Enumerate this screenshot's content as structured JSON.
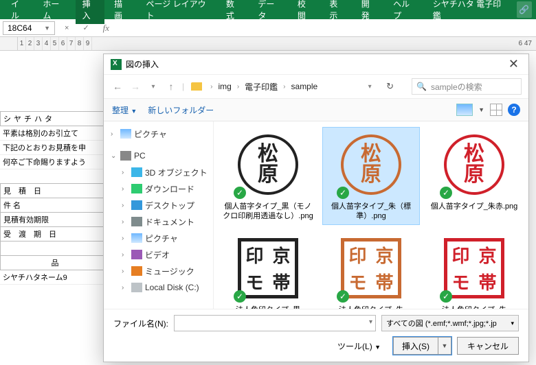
{
  "ribbon": {
    "tabs": [
      "イル",
      "ホーム",
      "挿入",
      "描画",
      "ページ レイアウト",
      "数式",
      "データ",
      "校閲",
      "表示",
      "開発",
      "ヘルプ",
      "シヤチハタ 電子印鑑"
    ]
  },
  "formula_bar": {
    "namebox": "18C64",
    "fx": "fx"
  },
  "colhdr_right": "6 47",
  "sheet": {
    "header_cells": [
      "シ",
      "ヤ",
      "チ",
      "ハ",
      "タ"
    ],
    "para": [
      "平素は格別のお引立て",
      "下記のとおりお見積を申",
      "何卒ご下命賜りますよう"
    ],
    "rows": [
      "見　積　日",
      "件 名",
      "見積有効期限",
      "受　渡　期　日",
      "",
      "品"
    ],
    "footer": "シヤチハタネーム9"
  },
  "dialog": {
    "title": "図の挿入",
    "crumbs": [
      "img",
      "電子印鑑",
      "sample"
    ],
    "search_placeholder": "sampleの検索",
    "organize": "整理",
    "newfolder": "新しいフォルダー",
    "tree": {
      "pictures": "ピクチャ",
      "pc": "PC",
      "children": [
        "3D オブジェクト",
        "ダウンロード",
        "デスクトップ",
        "ドキュメント",
        "ピクチャ",
        "ビデオ",
        "ミュージック",
        "Local Disk (C:)"
      ]
    },
    "files": [
      {
        "name": "個人苗字タイプ_黒（モノクロ印刷用透過なし）.png",
        "color": "#222",
        "shape": "round",
        "sel": false
      },
      {
        "name": "個人苗字タイプ_朱（標準）.png",
        "color": "#c86a32",
        "shape": "round",
        "sel": true
      },
      {
        "name": "個人苗字タイプ_朱赤.png",
        "color": "#d0202a",
        "shape": "round",
        "sel": false
      },
      {
        "name": "法人角印タイプ_黒",
        "color": "#222",
        "shape": "square",
        "sel": false
      },
      {
        "name": "法人角印タイプ_朱",
        "color": "#c86a32",
        "shape": "square",
        "sel": false
      },
      {
        "name": "法人角印タイプ_朱",
        "color": "#d0202a",
        "shape": "square",
        "sel": false
      }
    ],
    "hanko_round_text": [
      "松",
      "原"
    ],
    "hanko_square_text": [
      "印",
      "京",
      "モ",
      "帯"
    ],
    "filename_label": "ファイル名(N):",
    "filter": "すべての図 (*.emf;*.wmf;*.jpg;*.jp",
    "tools": "ツール(L)",
    "insert": "挿入(S)",
    "cancel": "キャンセル"
  }
}
